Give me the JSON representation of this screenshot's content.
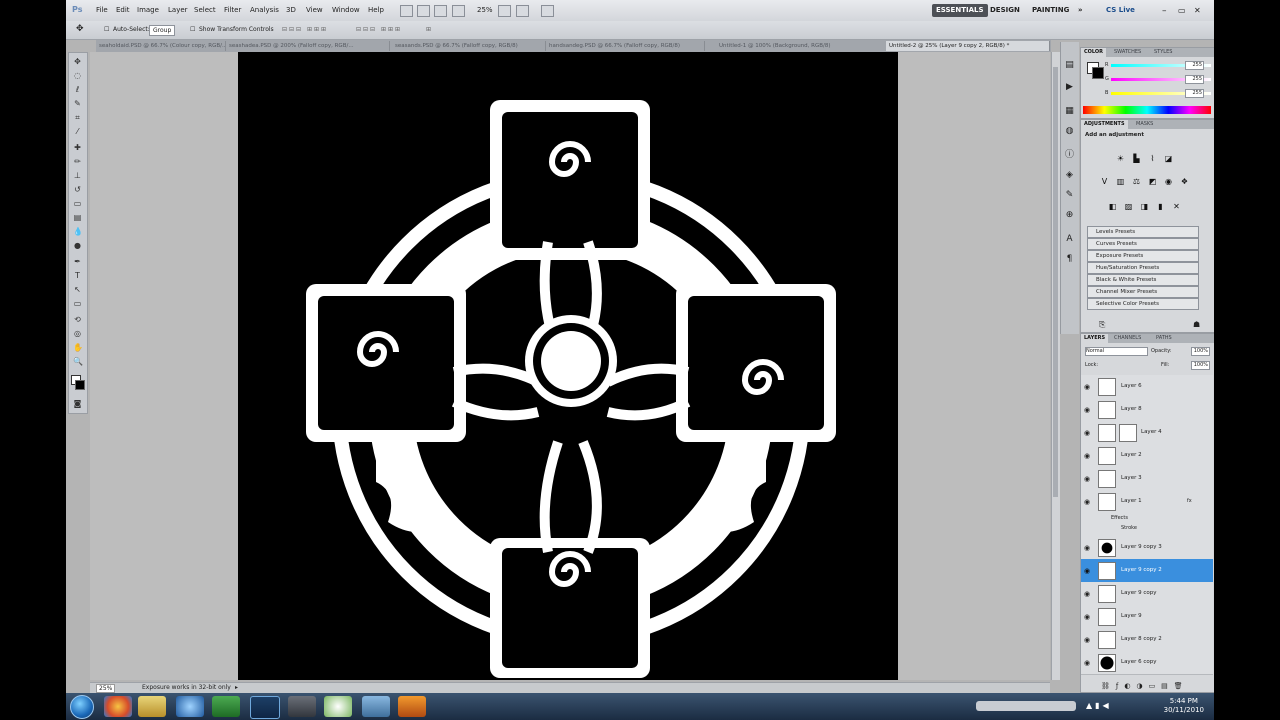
{
  "app": {
    "logo": "Ps"
  },
  "menubar": {
    "items": [
      "File",
      "Edit",
      "Image",
      "Layer",
      "Select",
      "Filter",
      "Analysis",
      "3D",
      "View",
      "Window",
      "Help"
    ],
    "zoom": "25%",
    "workspaces": [
      "ESSENTIALS",
      "DESIGN",
      "PAINTING"
    ],
    "more": "»",
    "cslive": "CS Live"
  },
  "options": {
    "auto_select": "Auto-Select:",
    "group_value": "Group",
    "show_transform": "Show Transform Controls"
  },
  "tabs": [
    "seaholdaid.PSD @ 66.7% (Colour copy, RGB/...",
    "seashadea.PSD @ 200% (Falloff copy, RGB/...",
    "seasands.PSD @ 66.7% (Falloff copy, RGB/8)",
    "handsandeg.PSD @ 66.7% (Falloff copy, RGB/8)",
    "Untitled-1 @ 100% (Background, RGB/8)",
    "Untitled-2 @ 25% (Layer 9 copy 2, RGB/8) *"
  ],
  "status": {
    "zoom": "25%",
    "info": "Exposure works in 32-bit only"
  },
  "panels": {
    "color_tabs": [
      "COLOR",
      "SWATCHES",
      "STYLES"
    ],
    "r": "255",
    "g": "255",
    "b": "255",
    "adjust_tabs": [
      "ADJUSTMENTS",
      "MASKS"
    ],
    "add_adjustment": "Add an adjustment",
    "presets": [
      "Levels Presets",
      "Curves Presets",
      "Exposure Presets",
      "Hue/Saturation Presets",
      "Black & White Presets",
      "Channel Mixer Presets",
      "Selective Color Presets"
    ],
    "layers_tabs": [
      "LAYERS",
      "CHANNELS",
      "PATHS"
    ],
    "blend_mode": "Normal",
    "opacity_label": "Opacity:",
    "opacity": "100%",
    "lock_label": "Lock:",
    "fill_label": "Fill:",
    "fill": "100%"
  },
  "layers": [
    {
      "name": "Layer 6"
    },
    {
      "name": "Layer 8"
    },
    {
      "name": "Layer 4"
    },
    {
      "name": "Layer 2"
    },
    {
      "name": "Layer 3"
    },
    {
      "name": "Layer 1"
    },
    {
      "name": "Layer 9 copy 3"
    },
    {
      "name": "Layer 9 copy 2"
    },
    {
      "name": "Layer 9 copy"
    },
    {
      "name": "Layer 9"
    },
    {
      "name": "Layer 8 copy 2"
    },
    {
      "name": "Layer 6 copy"
    }
  ],
  "effects": {
    "label": "Effects",
    "stroke": "Stroke",
    "fx": "fx"
  },
  "clock": {
    "time": "5:44 PM",
    "date": "30/11/2010"
  },
  "colors": {
    "selected_layer": "#3a8fde",
    "canvas": "#000000",
    "artwork": "#ffffff"
  }
}
